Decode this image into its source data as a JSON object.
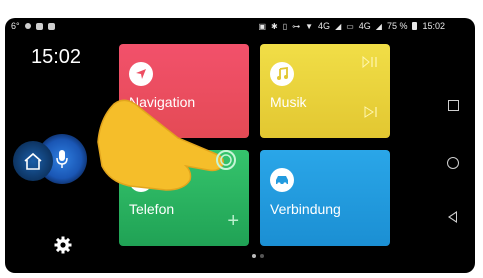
{
  "status_bar": {
    "left_temp": "6°",
    "right_text": "4G",
    "volte_text": "4G",
    "battery": "75 %",
    "time": "15:02",
    "icons": [
      "cast-icon",
      "bluetooth-icon",
      "vibrate-icon",
      "key-icon",
      "wifi-icon",
      "signal-icon",
      "battery-icon"
    ]
  },
  "left_rail": {
    "clock": "15:02",
    "home_icon": "home-icon",
    "mic_icon": "microphone-icon",
    "settings_icon": "gear-icon"
  },
  "tiles": {
    "navigation": {
      "label": "Navigation",
      "color": "#ee4e62",
      "icon": "navigation-arrow-icon"
    },
    "musik": {
      "label": "Musik",
      "color": "#ecd43e",
      "icon": "music-note-icon",
      "controls": [
        "play-pause-icon",
        "skip-next-icon"
      ]
    },
    "telefon": {
      "label": "Telefon",
      "color": "#2cb660",
      "icon": "phone-icon",
      "extra": "+"
    },
    "verbindung": {
      "label": "Verbindung",
      "color": "#229bdf",
      "icon": "car-icon"
    }
  },
  "right_rail": {
    "recent_icon": "recent-apps-icon",
    "home_icon": "home-circle-icon",
    "back_icon": "back-icon"
  },
  "pager": {
    "pages": 2,
    "active": 1
  },
  "overlay": {
    "icon": "pointing-hand-icon",
    "color": "#f5be2a"
  }
}
